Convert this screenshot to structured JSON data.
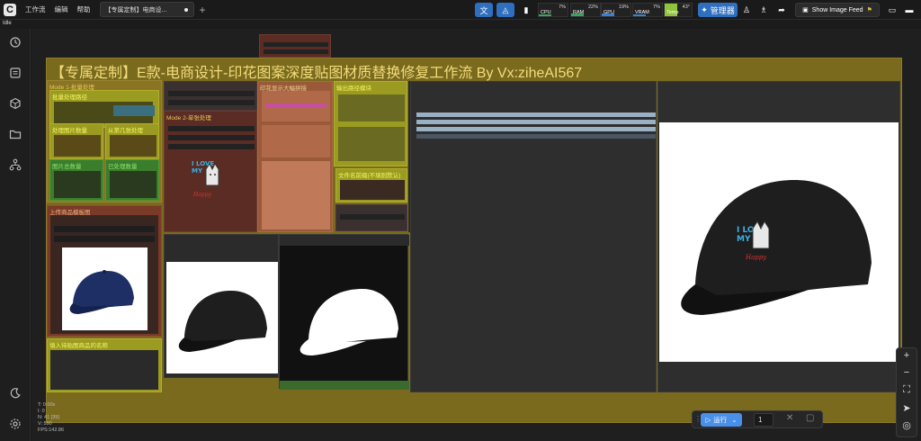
{
  "app": {
    "menu": [
      "工作流",
      "编辑",
      "帮助"
    ],
    "tab_title": "【专属定制】电商设...",
    "status": "Idle"
  },
  "toolbar": {
    "manager_label": "管理器",
    "image_feed_label": "Show Image Feed",
    "meters": [
      {
        "name": "CPU",
        "percent": 7,
        "color": "#3ba65a"
      },
      {
        "name": "RAM",
        "percent": 22,
        "color": "#3ba65a"
      },
      {
        "name": "GPU",
        "percent": 19,
        "color": "#3b7fd6"
      },
      {
        "name": "VRAM",
        "percent": 7,
        "color": "#3b7fd6"
      },
      {
        "name": "Temp",
        "value": "43°",
        "color": "#8fc33a"
      }
    ]
  },
  "sidebar": {
    "icons": [
      "history-icon",
      "queue-icon",
      "model-library-icon",
      "workflows-icon",
      "node-library-icon",
      "theme-toggle-icon",
      "settings-icon"
    ]
  },
  "workflow": {
    "main_title": "【专属定制】E款-电商设计-印花图案深度贴图材质替换修复工作流 By Vx:ziheAI567",
    "groups": {
      "mode1": "Mode 1-批量处理",
      "batch_path": "批量处理路径",
      "image_count": "处理图片数量",
      "start_index": "从第几张处理",
      "image_total": "图片总数量",
      "processed": "已处理数量",
      "mode2": "Mode 2-单张处理",
      "upload": "上传商品模板图",
      "product_name": "填入待贴图商品的名称",
      "texture": "印花显示大幅拼接",
      "output_path": "输出路径模块",
      "filename": "文件名前缀(不填则默认)"
    }
  },
  "canvas_stats": {
    "lines": [
      "T: 0.00s",
      "I: 0",
      "N: 41 [39]",
      "V: 590",
      "FPS:142.86"
    ]
  },
  "runbar": {
    "run_label": "运行",
    "batch_count": "1"
  },
  "colors": {
    "group_olive": "#7a6a1e",
    "group_yellow": "#9b9b22",
    "group_green": "#3a7d2c",
    "node_brown": "#5a2c24",
    "node_dark": "#2e2e2e",
    "accent_blue": "#4a8fe8"
  }
}
